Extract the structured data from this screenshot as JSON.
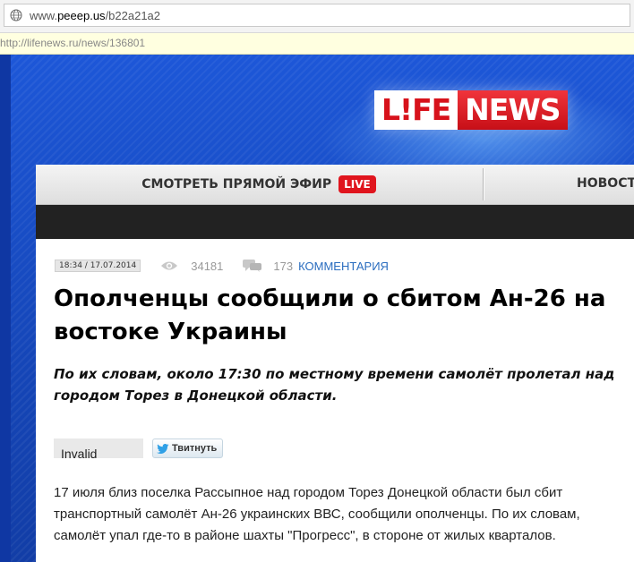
{
  "browser": {
    "address_prefix": "www.",
    "address_domain": "peeep.us",
    "address_path": "/b22a21a2",
    "link_hint": "http://lifenews.ru/news/136801"
  },
  "logo": {
    "left_text": "L!FE",
    "right_text": "NEWS"
  },
  "nav": {
    "live_label": "СМОТРЕТЬ ПРЯМОЙ ЭФИР",
    "live_badge": "LIVE",
    "news_label": "НОВОСТИ"
  },
  "article": {
    "datetime": "18:34 / 17.07.2014",
    "views": "34181",
    "comments_count": "173",
    "comments_label": "КОММЕНТАРИЯ",
    "title": "Ополченцы сообщили о сбитом Ан-26 на востоке Украины",
    "lead": "По их словам, около 17:30 по местному времени самолёт пролетал над городом Торез в Донецкой области.",
    "share_invalid": "Invalid",
    "tweet_label": "Твитнуть",
    "body": "17 июля близ поселка Рассыпное над городом Торез Донецкой области был сбит транспортный самолёт Ан-26 украинских ВВС, сообщили ополченцы. По их словам, самолёт упал где-то в районе шахты \"Прогресс\", в стороне от жилых кварталов."
  },
  "icons": {
    "globe": "globe-icon",
    "views": "eye-icon",
    "comments": "speech-bubble-icon",
    "twitter": "twitter-bird-icon"
  },
  "colors": {
    "brand_red": "#e0151e",
    "header_blue": "#1a4fc9",
    "link_blue": "#2a6dbf"
  }
}
